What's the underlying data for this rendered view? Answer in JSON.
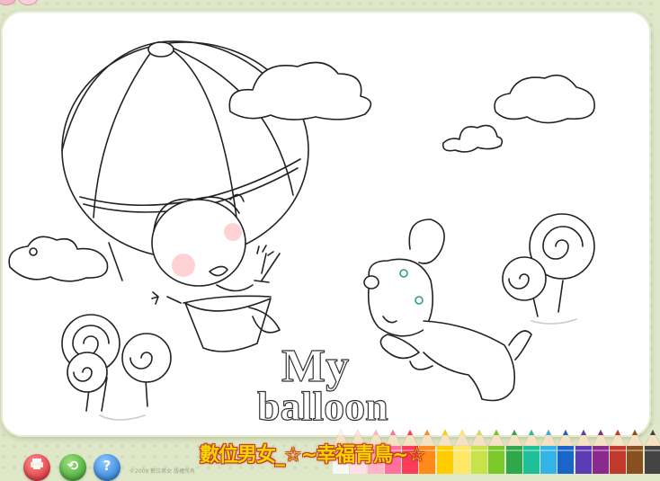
{
  "scene": {
    "title_line1": "My",
    "title_line2": "balloon"
  },
  "footer": {
    "site_title": "數位男女_☆~幸福青鳥~☆",
    "copyright": "©2008 數位男女 版權所有"
  },
  "buttons": {
    "reset_glyph": "⟲",
    "help_glyph": "?"
  },
  "palette": {
    "colors": [
      "#f7f7f7",
      "#ffe0e8",
      "#ffb3c7",
      "#ff6fa0",
      "#ff3b5c",
      "#ff8a1a",
      "#ffcc00",
      "#ffe866",
      "#c8e24a",
      "#7cc82a",
      "#2ea84a",
      "#1fbf9a",
      "#33b4e8",
      "#1a66c8",
      "#5c3cb4",
      "#8b2a8e",
      "#c0392b",
      "#8a4f1e",
      "#444444"
    ]
  },
  "colors": {
    "canvas_bg": "#ffffff",
    "page_bg": "#dfe7c9",
    "title_fill": "#f5d400",
    "title_outline": "#c0361f"
  }
}
